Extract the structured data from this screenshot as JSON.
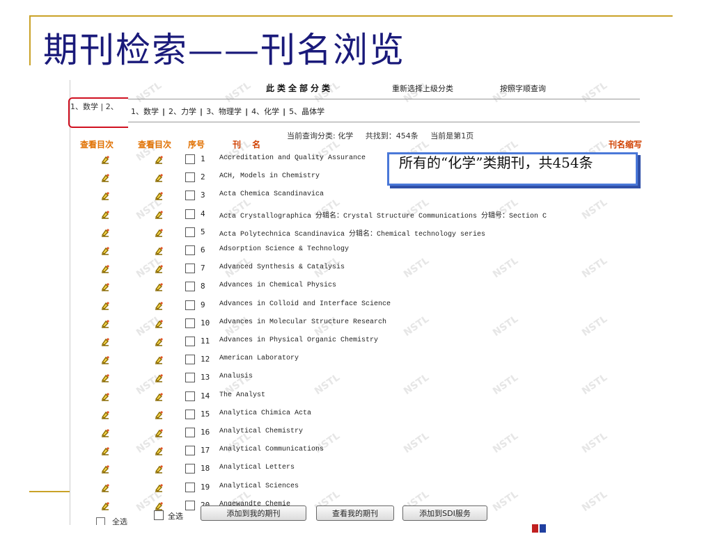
{
  "slide": {
    "title": "期刊检索——刊名浏览"
  },
  "back_panel": {
    "tab_text": "1、数学 | 2、",
    "column_header": "查看目次",
    "select_all_label": "全选"
  },
  "panel": {
    "top": {
      "all_categories": "此类全部分类",
      "reselect": "重新选择上级分类",
      "alpha_search": "按照字顺查询"
    },
    "tabs": [
      "1、数学",
      "2、力学",
      "3、物理学",
      "4、化学",
      "5、晶体学"
    ],
    "info": {
      "current_category": "当前查询分类:  化学",
      "found": "共找到：454条",
      "page": "当前是第1页"
    },
    "headers": {
      "view_contents": "查看目次",
      "seq": "序号",
      "journal": "刊 名",
      "abbrev": "刊名缩写"
    },
    "journals": [
      {
        "num": "1",
        "name": "Accreditation and Quality Assurance"
      },
      {
        "num": "2",
        "name": "ACH, Models in Chemistry"
      },
      {
        "num": "3",
        "name": "Acta Chemica Scandinavica"
      },
      {
        "num": "4",
        "name": "Acta Crystallographica 分辑名：Crystal Structure Communications 分辑号：Section C"
      },
      {
        "num": "5",
        "name": "Acta Polytechnica Scandinavica 分辑名：Chemical technology series"
      },
      {
        "num": "6",
        "name": "Adsorption Science & Technology"
      },
      {
        "num": "7",
        "name": "Advanced Synthesis & Catalysis"
      },
      {
        "num": "8",
        "name": "Advances in Chemical Physics"
      },
      {
        "num": "9",
        "name": "Advances in Colloid and Interface Science"
      },
      {
        "num": "10",
        "name": "Advances in Molecular Structure Research"
      },
      {
        "num": "11",
        "name": "Advances in Physical Organic Chemistry"
      },
      {
        "num": "12",
        "name": "American Laboratory"
      },
      {
        "num": "13",
        "name": "Analusis"
      },
      {
        "num": "14",
        "name": "The Analyst"
      },
      {
        "num": "15",
        "name": "Analytica Chimica Acta"
      },
      {
        "num": "16",
        "name": "Analytical Chemistry"
      },
      {
        "num": "17",
        "name": "Analytical Communications"
      },
      {
        "num": "18",
        "name": "Analytical Letters"
      },
      {
        "num": "19",
        "name": "Analytical Sciences"
      },
      {
        "num": "20",
        "name": "Angewandte Chemie"
      }
    ],
    "select_all_label": "全选",
    "buttons": {
      "add_my_journals": "添加到我的期刊",
      "view_my_journals": "查看我的期刊",
      "add_sdi": "添加到SDI服务"
    },
    "watermark": "NSTL"
  },
  "callout": {
    "text": "所有的“化学”类期刊，共454条"
  },
  "colors": {
    "title": "#1a1a7a",
    "gold_rule": "#c9a227",
    "header_orange": "#e07000",
    "callout_border": "#4a78d8",
    "highlight_red": "#d01020"
  }
}
